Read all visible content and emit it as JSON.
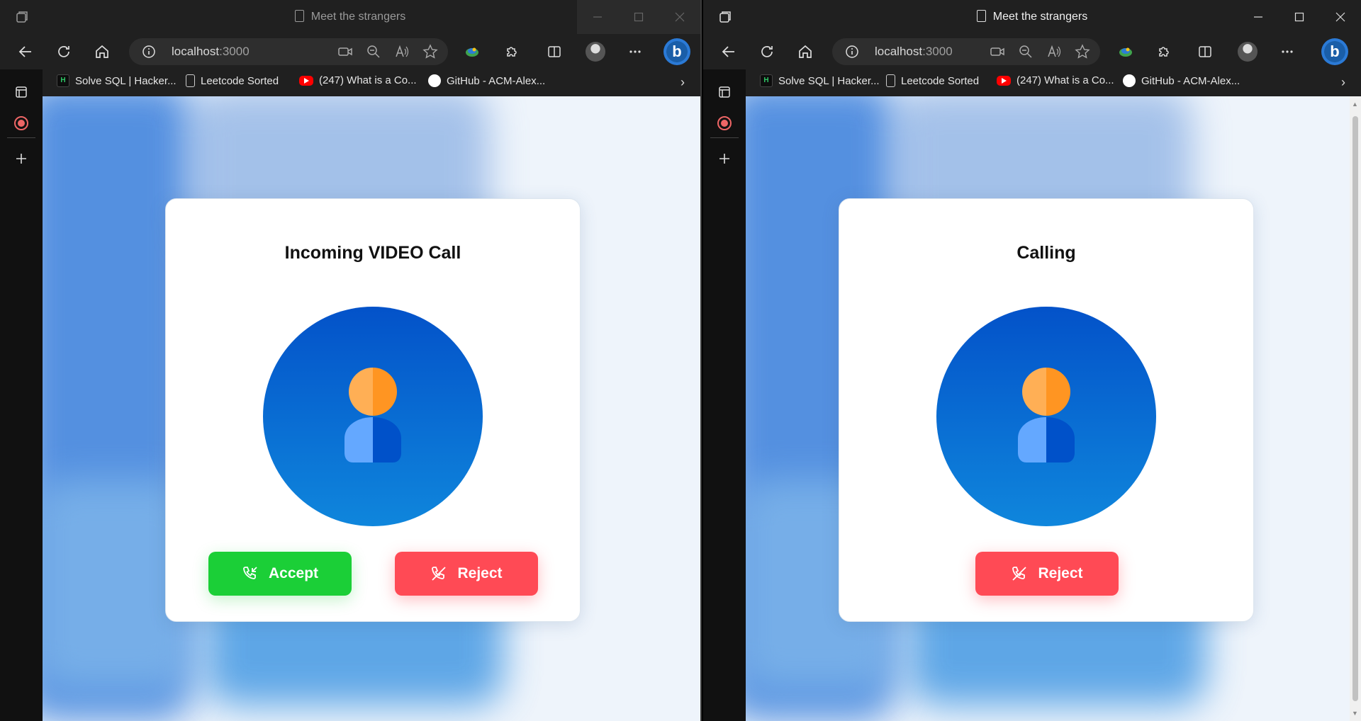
{
  "browser": {
    "tab_title": "Meet the strangers",
    "url_host": "localhost",
    "url_port": ":3000",
    "bookmarks": [
      {
        "label": "Solve SQL | Hacker...",
        "icon": "hackerrank-icon"
      },
      {
        "label": "Leetcode Sorted",
        "icon": "document-icon"
      },
      {
        "label": "(247) What is a Co...",
        "icon": "youtube-icon"
      },
      {
        "label": "GitHub - ACM-Alex...",
        "icon": "github-icon"
      }
    ],
    "hackerrank_badge": "H"
  },
  "left_panel": {
    "title": "Incoming VIDEO Call",
    "accept_label": "Accept",
    "reject_label": "Reject"
  },
  "right_panel": {
    "title": "Calling",
    "reject_label": "Reject"
  },
  "colors": {
    "accept": "#1bcf37",
    "reject": "#ff4a55",
    "avatar_circle_top": "#0352c9",
    "avatar_circle_bottom": "#0f86dc",
    "avatar_head_light": "#ffaf55",
    "avatar_head_dark": "#ff9522",
    "avatar_body_light": "#64a8ff",
    "avatar_body_dark": "#0051c9"
  }
}
